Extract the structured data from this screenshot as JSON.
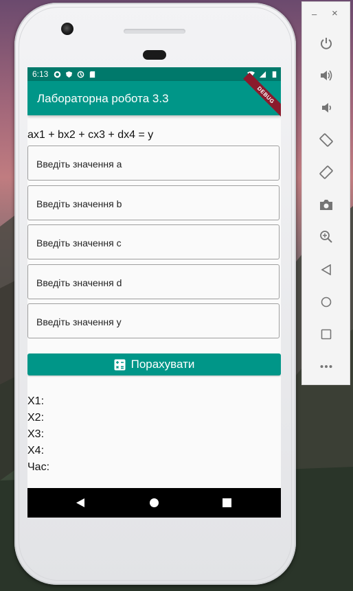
{
  "status_bar": {
    "time": "6:13",
    "debug_banner": "DEBUG"
  },
  "app_bar": {
    "title": "Лабораторна робота 3.3"
  },
  "formula": "ax1 + bx2 + cx3 + dx4 = y",
  "fields": [
    {
      "placeholder": "Введіть значення a",
      "value": ""
    },
    {
      "placeholder": "Введіть значення b",
      "value": ""
    },
    {
      "placeholder": "Введіть значення c",
      "value": ""
    },
    {
      "placeholder": "Введіть значення d",
      "value": ""
    },
    {
      "placeholder": "Введіть значення y",
      "value": ""
    }
  ],
  "calculate_button": {
    "label": "Порахувати",
    "icon": "calculator-icon"
  },
  "results": {
    "x1": "X1:",
    "x2": "X2:",
    "x3": "X3:",
    "x4": "X4:",
    "time": "Час:"
  },
  "colors": {
    "status_bar": "#00796b",
    "app_bar": "#009688",
    "button": "#009688",
    "debug": "#8b1a2c"
  },
  "toolbar": {
    "minimize": "–",
    "close": "×",
    "buttons": [
      "power-icon",
      "volume-up-icon",
      "volume-down-icon",
      "rotate-left-icon",
      "rotate-right-icon",
      "camera-icon",
      "zoom-icon",
      "back-icon",
      "home-icon",
      "overview-icon",
      "more-icon"
    ]
  }
}
